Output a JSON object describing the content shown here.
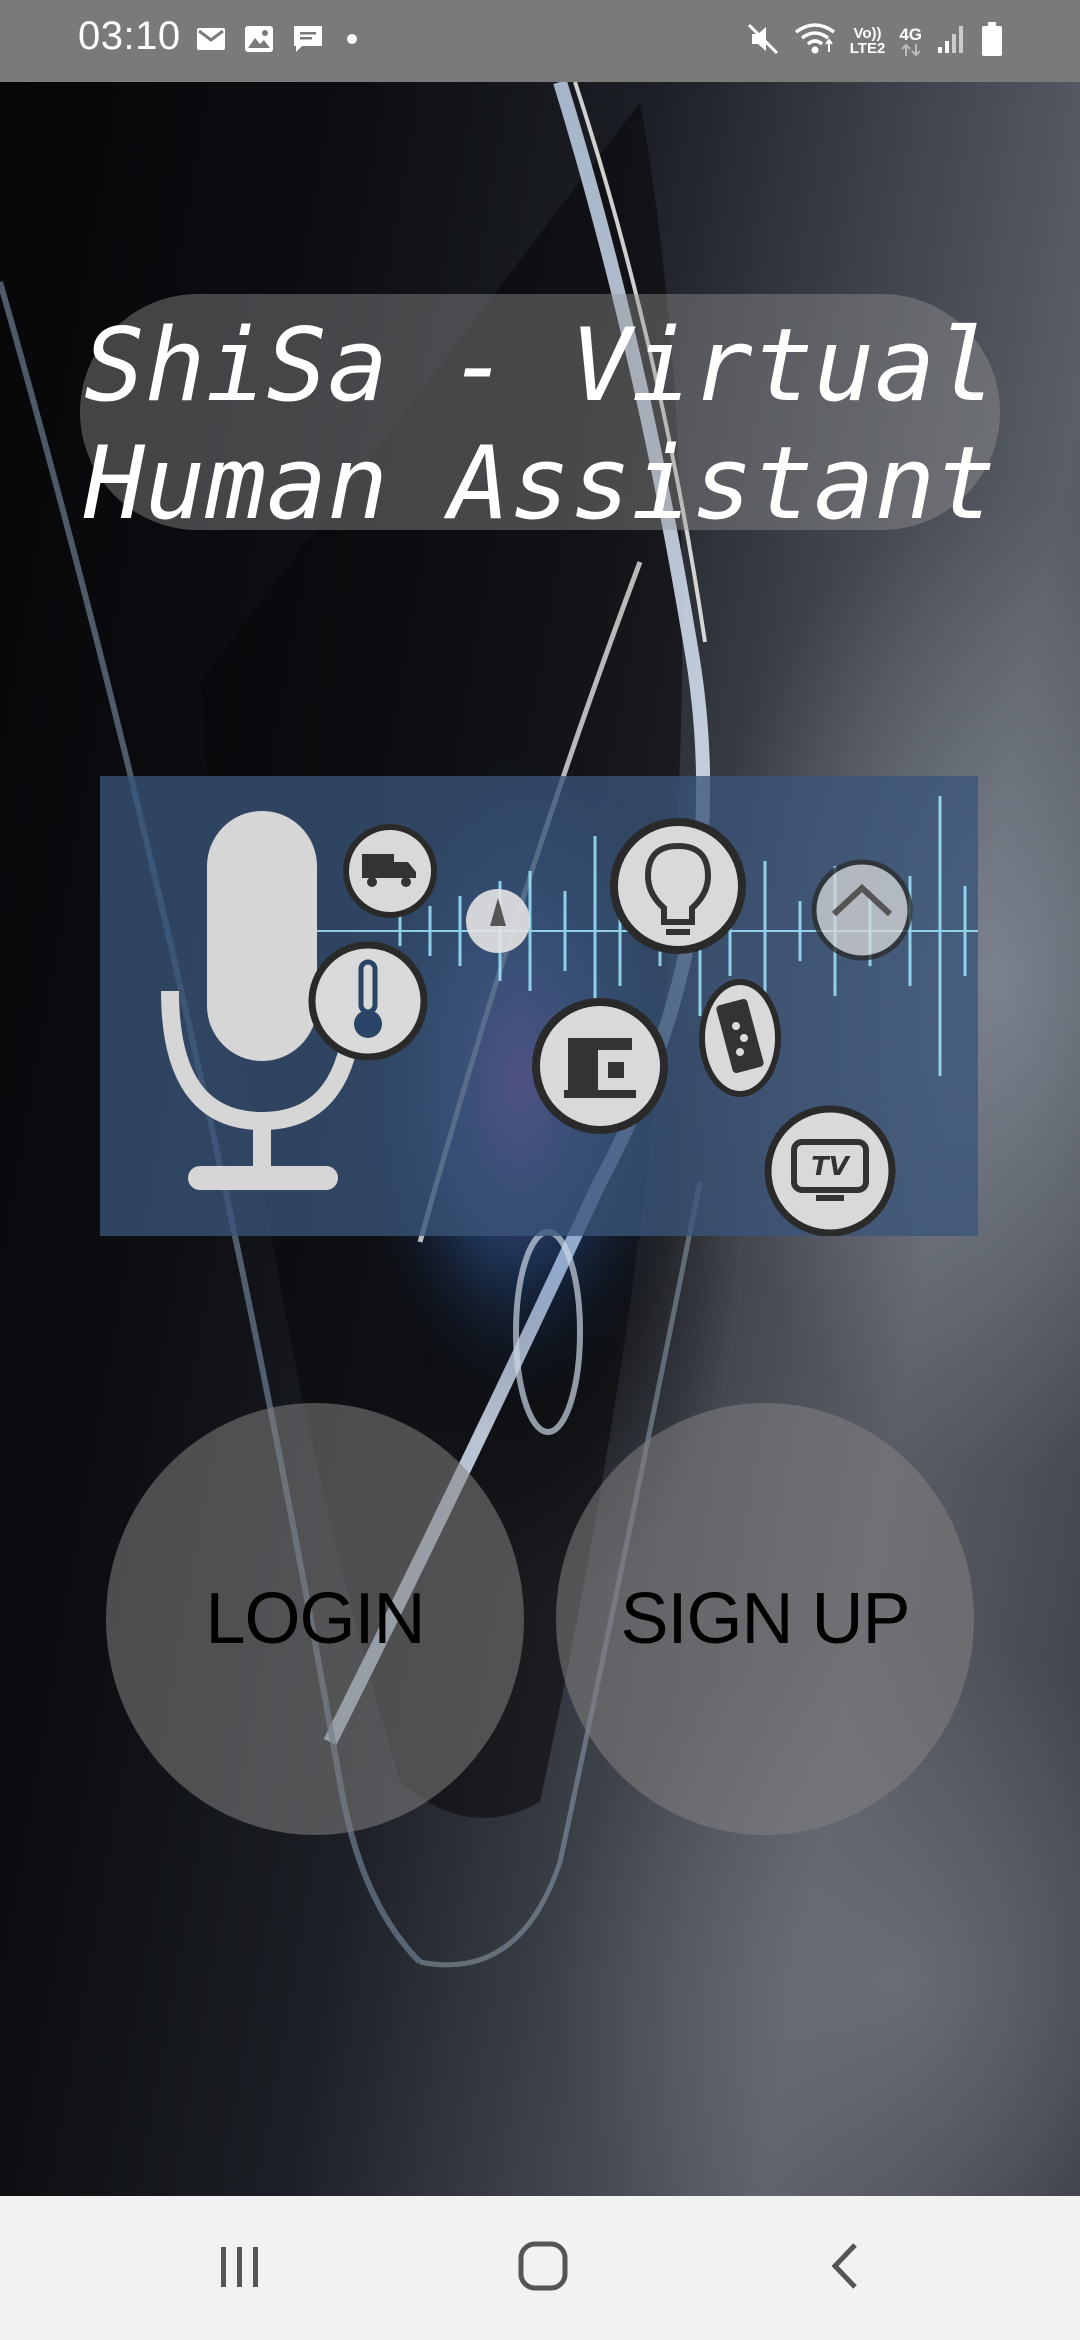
{
  "status_bar": {
    "time": "03:10",
    "left_icons": [
      "gmail-icon",
      "gallery-icon",
      "message-icon",
      "notification-dot-icon"
    ],
    "volte_label_top": "Vo))",
    "volte_label_bottom": "LTE2",
    "network_label": "4G",
    "right_icons": [
      "mute-icon",
      "wifi-icon",
      "volte-icon",
      "network-arrows-icon",
      "signal-icon",
      "battery-icon"
    ]
  },
  "app": {
    "title": "ShiSa - Virtual\nHuman Assistant",
    "banner_icons": [
      "microphone-icon",
      "truck-icon",
      "thermometer-icon",
      "lightbulb-icon",
      "coffee-machine-icon",
      "remote-control-icon",
      "tv-icon",
      "sound-wave-icon"
    ],
    "banner_tv_text": "TV"
  },
  "buttons": {
    "login_label": "LOGIN",
    "signup_label": "SIGN UP"
  },
  "nav_bar": {
    "icons": [
      "recents-icon",
      "home-icon",
      "back-icon"
    ]
  },
  "colors": {
    "status_bar_bg": "#7a7a7a",
    "nav_bar_bg": "#f2f2f2",
    "button_bg": "#828282",
    "banner_bg": "#3a5478"
  }
}
